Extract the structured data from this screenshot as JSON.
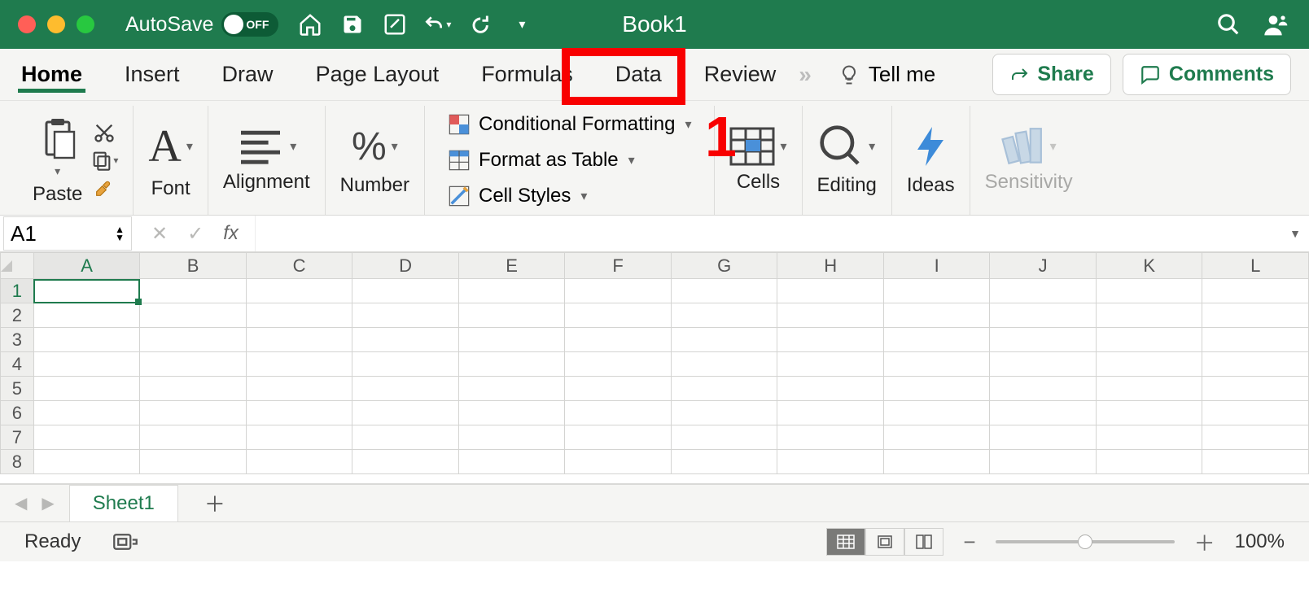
{
  "title_bar": {
    "autosave_label": "AutoSave",
    "autosave_state": "OFF",
    "document_title": "Book1"
  },
  "tabs": {
    "items": [
      "Home",
      "Insert",
      "Draw",
      "Page Layout",
      "Formulas",
      "Data",
      "Review"
    ],
    "tell_me": "Tell me",
    "share": "Share",
    "comments": "Comments",
    "active_index": 0,
    "highlighted_index": 5
  },
  "annotation": {
    "number": "1"
  },
  "ribbon": {
    "paste": "Paste",
    "font": "Font",
    "alignment": "Alignment",
    "number": "Number",
    "conditional_formatting": "Conditional Formatting",
    "format_as_table": "Format as Table",
    "cell_styles": "Cell Styles",
    "cells": "Cells",
    "editing": "Editing",
    "ideas": "Ideas",
    "sensitivity": "Sensitivity"
  },
  "formula_bar": {
    "cell_reference": "A1",
    "formula_value": ""
  },
  "grid": {
    "columns": [
      "A",
      "B",
      "C",
      "D",
      "E",
      "F",
      "G",
      "H",
      "I",
      "J",
      "K",
      "L"
    ],
    "rows": [
      1,
      2,
      3,
      4,
      5,
      6,
      7,
      8
    ],
    "selected_cell": "A1"
  },
  "sheet_tabs": {
    "sheets": [
      "Sheet1"
    ]
  },
  "status_bar": {
    "status_text": "Ready",
    "zoom_percent": "100%"
  }
}
